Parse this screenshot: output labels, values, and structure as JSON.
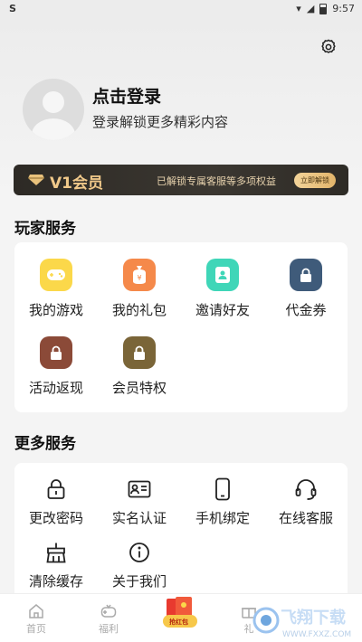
{
  "status_bar": {
    "time": "9:57"
  },
  "profile": {
    "title": "点击登录",
    "subtitle": "登录解锁更多精彩内容"
  },
  "vip": {
    "title": "V1会员",
    "desc": "已解锁专属客服等多项权益",
    "button": "立即解锁"
  },
  "player_services": {
    "title": "玩家服务",
    "items": [
      {
        "label": "我的游戏",
        "color": "#fbd84a"
      },
      {
        "label": "我的礼包",
        "color": "#f5894a"
      },
      {
        "label": "邀请好友",
        "color": "#3fd6b8"
      },
      {
        "label": "代金券",
        "color": "#3f5b7a"
      },
      {
        "label": "活动返现",
        "color": "#8b4a38"
      },
      {
        "label": "会员特权",
        "color": "#7a6538"
      }
    ]
  },
  "more_services": {
    "title": "更多服务",
    "items": [
      {
        "label": "更改密码",
        "icon": "lock-icon"
      },
      {
        "label": "实名认证",
        "icon": "id-card-icon"
      },
      {
        "label": "手机绑定",
        "icon": "phone-icon"
      },
      {
        "label": "在线客服",
        "icon": "headset-icon"
      },
      {
        "label": "清除缓存",
        "icon": "broom-icon"
      },
      {
        "label": "关于我们",
        "icon": "info-icon"
      }
    ]
  },
  "tabbar": {
    "items": [
      {
        "label": "首页"
      },
      {
        "label": "福利"
      },
      {
        "label": "抢红包"
      },
      {
        "label": "礼"
      }
    ]
  },
  "watermark": {
    "text": "飞翔下载",
    "url": "WWW.FXXZ.COM"
  }
}
